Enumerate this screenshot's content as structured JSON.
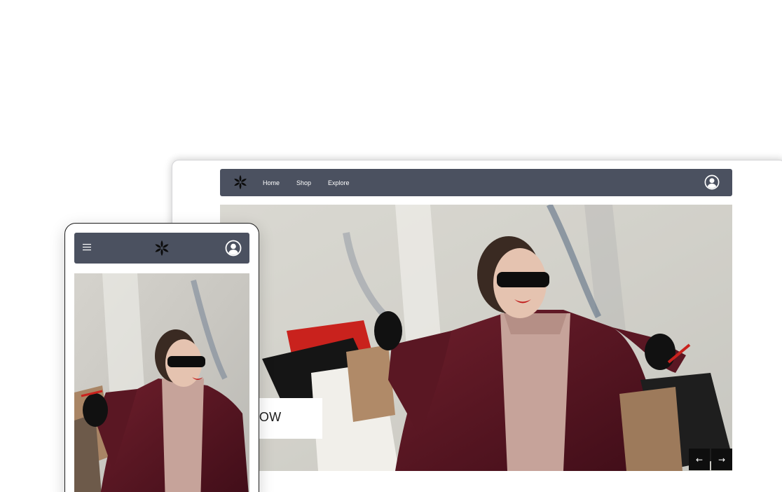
{
  "desktop": {
    "nav": {
      "links": [
        {
          "label": "Home"
        },
        {
          "label": "Shop"
        },
        {
          "label": "Explore"
        }
      ],
      "background": "#4b5160"
    },
    "hero": {
      "cta_label": "SHOP NOW",
      "prev_icon": "←",
      "next_icon": "→"
    }
  },
  "mobile": {
    "nav": {
      "menu_icon": "hamburger-menu-icon",
      "background": "#4b5160"
    }
  },
  "icons": {
    "logo": "flower-logo-icon",
    "profile": "user-circle-icon",
    "prev": "arrow-left-icon",
    "next": "arrow-right-icon"
  }
}
